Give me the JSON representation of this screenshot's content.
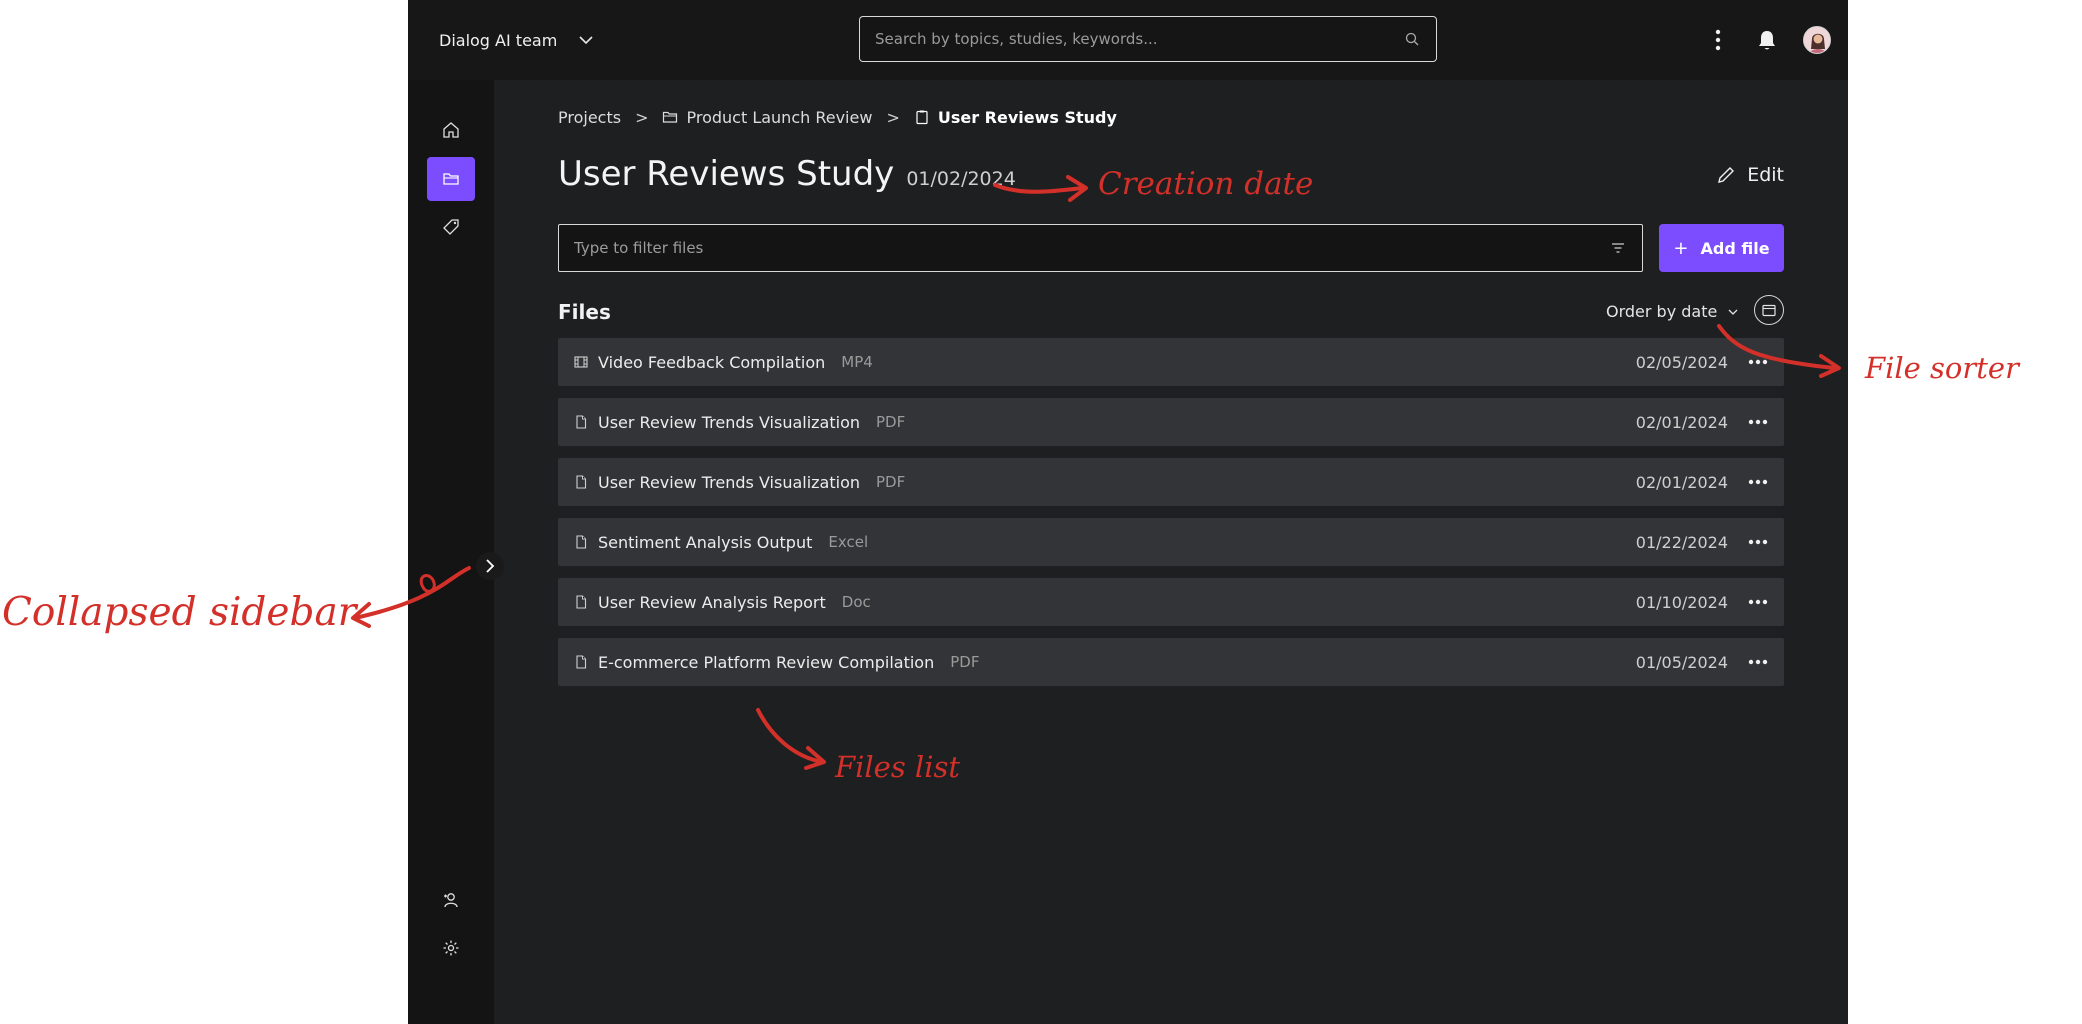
{
  "header": {
    "team_name": "Dialog AI team",
    "search_placeholder": "Search by topics, studies, keywords..."
  },
  "breadcrumb": {
    "items": [
      "Projects",
      "Product Launch Review",
      "User Reviews Study"
    ],
    "separator": ">"
  },
  "page": {
    "title": "User Reviews Study",
    "creation_date": "01/02/2024",
    "edit_label": "Edit"
  },
  "filter": {
    "placeholder": "Type to filter files",
    "add_file_label": "Add file"
  },
  "files": {
    "heading": "Files",
    "order_label": "Order by date",
    "rows": [
      {
        "name": "Video Feedback Compilation",
        "type": "MP4",
        "date": "02/05/2024",
        "icon": "film-icon"
      },
      {
        "name": "User Review Trends Visualization",
        "type": "PDF",
        "date": "02/01/2024",
        "icon": "document-icon"
      },
      {
        "name": "User Review Trends Visualization",
        "type": "PDF",
        "date": "02/01/2024",
        "icon": "document-icon"
      },
      {
        "name": "Sentiment Analysis Output",
        "type": "Excel",
        "date": "01/22/2024",
        "icon": "document-icon"
      },
      {
        "name": "User Review Analysis Report",
        "type": "Doc",
        "date": "01/10/2024",
        "icon": "document-icon"
      },
      {
        "name": "E-commerce Platform Review Compilation",
        "type": "PDF",
        "date": "01/05/2024",
        "icon": "document-icon"
      }
    ]
  },
  "annotations": {
    "creation_date": "Creation date",
    "file_sorter": "File sorter",
    "collapsed_sidebar": "Collapsed sidebar",
    "files_list": "Files list"
  },
  "colors": {
    "accent": "#7c4dff",
    "annotation": "#d3302a",
    "background": "#1e1f21",
    "row": "#333437"
  }
}
